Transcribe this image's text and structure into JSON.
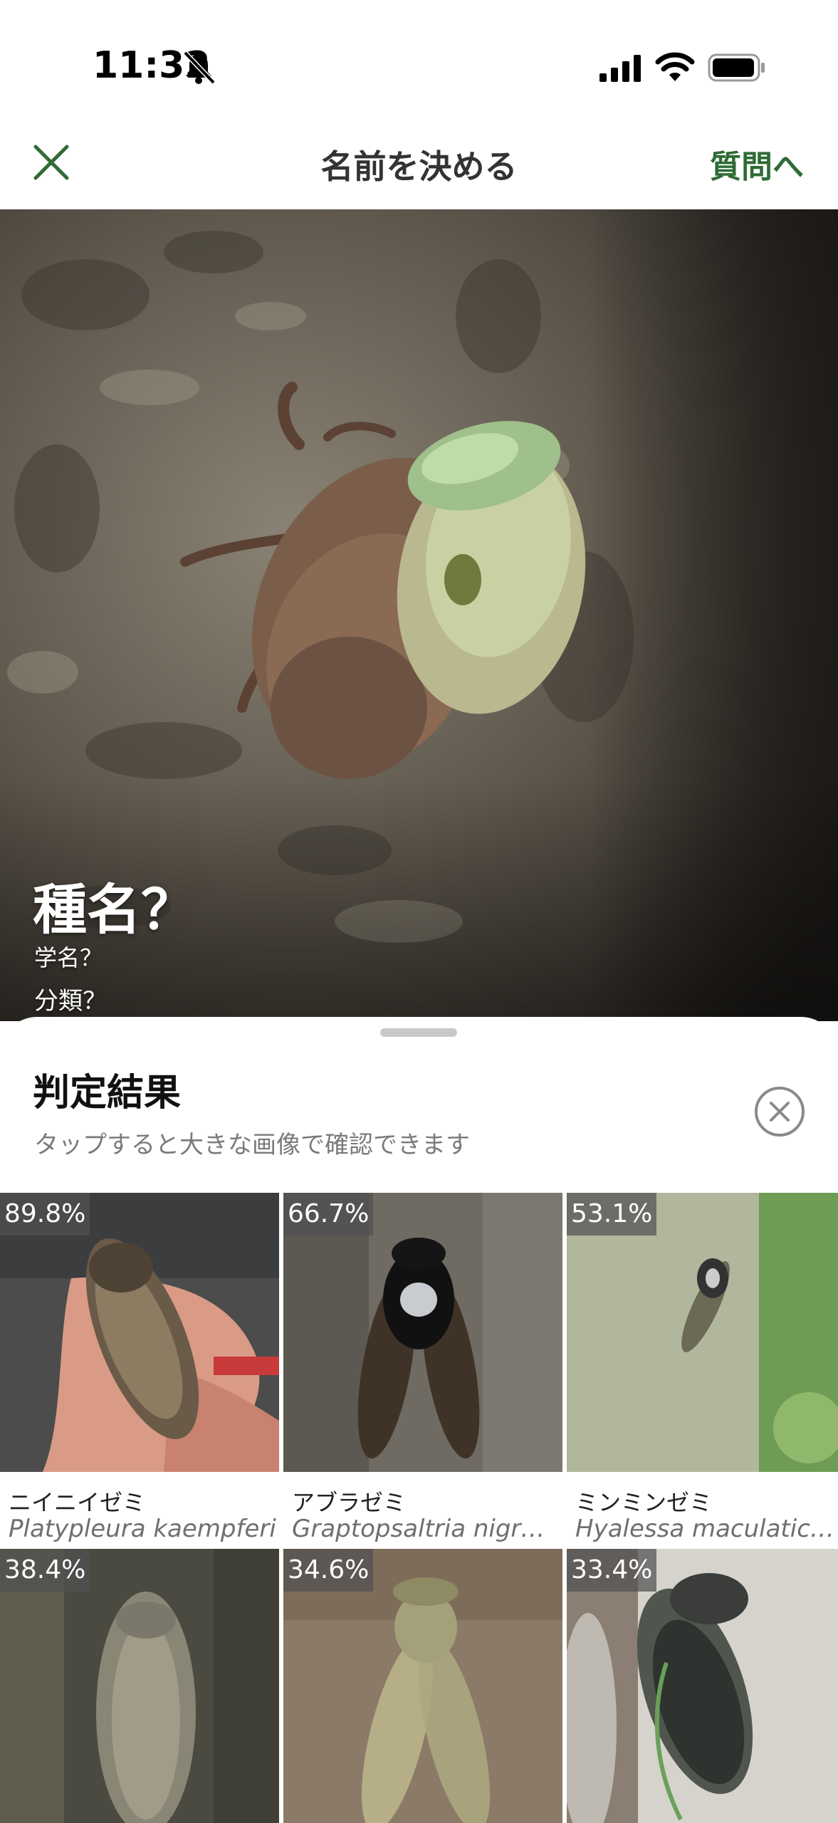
{
  "status_bar": {
    "time": "11:32"
  },
  "nav": {
    "close_icon": "close-icon",
    "title": "名前を決める",
    "next_label": "質問へ"
  },
  "hero": {
    "species_name": "種名？",
    "scientific_name": "学名？",
    "classification": "分類？"
  },
  "sheet": {
    "title": "判定結果",
    "subtitle": "タップすると大きな画像で確認できます",
    "results": [
      {
        "confidence": "89.8%",
        "name": "ニイニイゼミ",
        "scientific": "Platypleura kaempferi"
      },
      {
        "confidence": "66.7%",
        "name": "アブラゼミ",
        "scientific": "Graptopsaltria nigrofuscata"
      },
      {
        "confidence": "53.1%",
        "name": "ミンミンゼミ",
        "scientific": "Hyalessa maculaticollis"
      },
      {
        "confidence": "38.4%",
        "name": "",
        "scientific": ""
      },
      {
        "confidence": "34.6%",
        "name": "",
        "scientific": ""
      },
      {
        "confidence": "33.4%",
        "name": "",
        "scientific": ""
      }
    ]
  },
  "colors": {
    "accent": "#2e6b35",
    "text": "#333333",
    "subtle": "#7a7a7a"
  }
}
